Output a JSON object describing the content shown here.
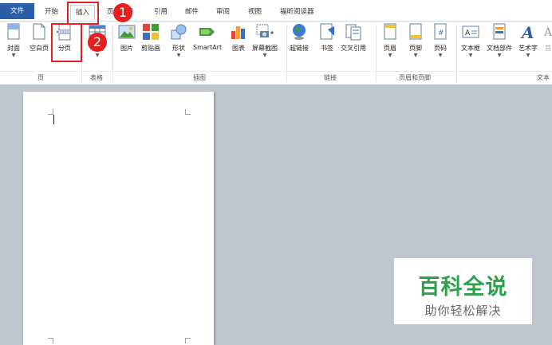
{
  "tabs": {
    "file": "文件",
    "home": "开始",
    "insert": "插入",
    "layout": "页",
    "layout_tail": "局",
    "references": "引用",
    "mailings": "邮件",
    "review": "审阅",
    "view": "视图",
    "foxit": "福昕阅读器"
  },
  "ribbon": {
    "cover": "封面",
    "blank_page": "空白页",
    "page_break": "分页",
    "table": "表格",
    "picture": "图片",
    "clipart": "剪贴画",
    "shapes": "形状",
    "smartart": "SmartArt",
    "chart": "图表",
    "screenshot": "屏幕截图",
    "hyperlink": "超链接",
    "bookmark": "书签",
    "cross_ref": "交叉引用",
    "header": "页眉",
    "footer": "页脚",
    "page_number": "页码",
    "textbox": "文本框",
    "quick_parts": "文档部件",
    "wordart": "艺术字",
    "dropcap": "首"
  },
  "groups": {
    "pages": "页",
    "tables": "表格",
    "illustrations": "插图",
    "links": "链接",
    "header_footer": "页眉和页脚",
    "text": "文本"
  },
  "callouts": {
    "one": "1",
    "two": "2"
  },
  "watermark": {
    "title": "百科全说",
    "subtitle": "助你轻松解决"
  },
  "colors": {
    "file_tab": "#2a5ea8",
    "callout": "#e61e1e",
    "watermark_green": "#2fa04a"
  }
}
